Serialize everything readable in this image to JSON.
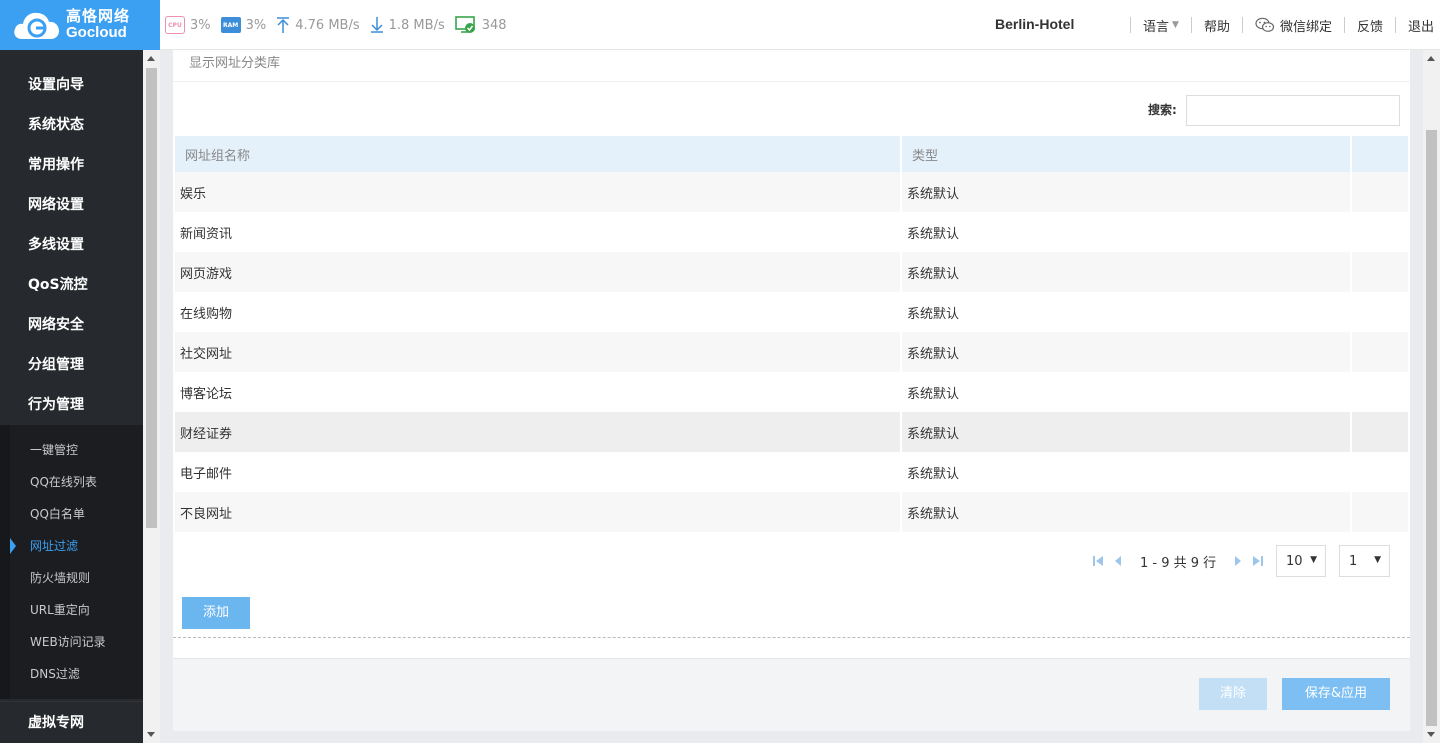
{
  "brand": {
    "name_cn": "高恪网络",
    "name_en": "Gocloud"
  },
  "stats": {
    "cpu_label": "CPU",
    "cpu": "3%",
    "ram_label": "RAM",
    "ram": "3%",
    "upload": "4.76 MB/s",
    "download": "1.8 MB/s",
    "clients": "348"
  },
  "header": {
    "device_name": "Berlin-Hotel",
    "nav": [
      "语言",
      "帮助",
      "微信绑定",
      "反馈",
      "退出"
    ]
  },
  "sidebar": {
    "items": [
      "设置向导",
      "系统状态",
      "常用操作",
      "网络设置",
      "多线设置",
      "QoS流控",
      "网络安全",
      "分组管理",
      "行为管理"
    ],
    "sub_items": [
      "一键管控",
      "QQ在线列表",
      "QQ白名单",
      "网址过滤",
      "防火墙规则",
      "URL重定向",
      "WEB访问记录",
      "DNS过滤"
    ],
    "active_sub": "网址过滤",
    "bottom_item": "虚拟专网"
  },
  "main": {
    "panel_title": "显示网址分类库",
    "search_label": "搜索:",
    "search_value": "",
    "columns": [
      "网址组名称",
      "类型",
      ""
    ],
    "rows": [
      {
        "name": "娱乐",
        "type": "系统默认"
      },
      {
        "name": "新闻资讯",
        "type": "系统默认"
      },
      {
        "name": "网页游戏",
        "type": "系统默认"
      },
      {
        "name": "在线购物",
        "type": "系统默认"
      },
      {
        "name": "社交网址",
        "type": "系统默认"
      },
      {
        "name": "博客论坛",
        "type": "系统默认"
      },
      {
        "name": "财经证券",
        "type": "系统默认"
      },
      {
        "name": "电子邮件",
        "type": "系统默认"
      },
      {
        "name": "不良网址",
        "type": "系统默认"
      }
    ],
    "pager": {
      "info": "1 - 9 共 9 行",
      "page_size": "10",
      "page": "1"
    },
    "add_button": "添加",
    "clear_button": "清除",
    "save_button": "保存&应用"
  },
  "colors": {
    "brand_blue": "#3ba0f2",
    "sidebar_bg": "#26292e",
    "header_row_bg": "#e4f1fb"
  }
}
